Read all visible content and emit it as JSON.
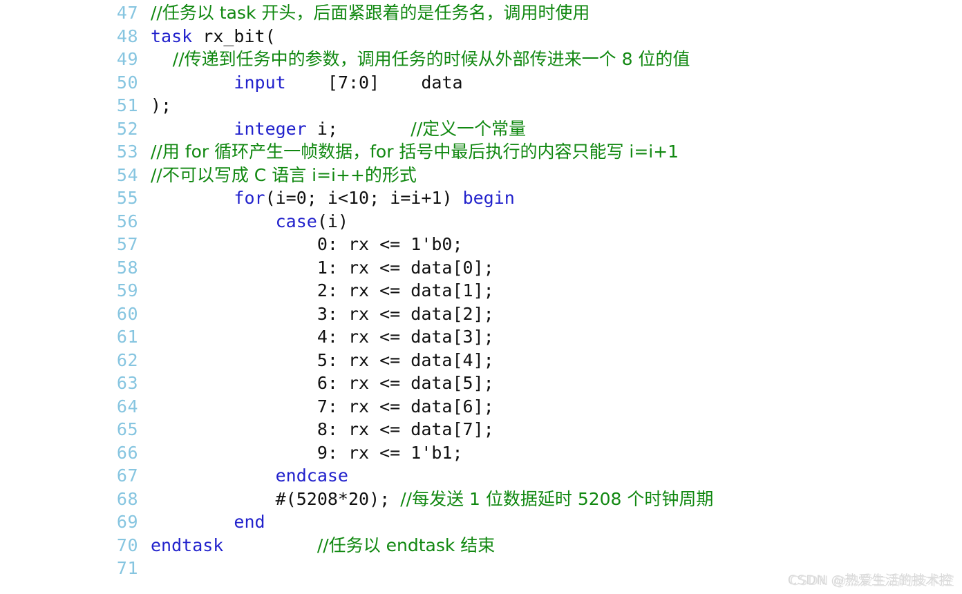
{
  "editor": {
    "language": "verilog",
    "first_line_number": 47,
    "colors": {
      "background": "#ffffff",
      "line_number": "#86c5e0",
      "keyword": "#2222cc",
      "comment": "#118811",
      "plain_text": "#111111",
      "watermark": "#d8d8d8"
    }
  },
  "watermark": {
    "text": "CSDN @热爱生活的技术控"
  },
  "lines": [
    {
      "number": "47",
      "tokens": [
        {
          "t": "//任务以 task 开头，后面紧跟着的是任务名，调用时使用",
          "c": "cmt"
        }
      ]
    },
    {
      "number": "48",
      "tokens": [
        {
          "t": "task",
          "c": "kw"
        },
        {
          "t": " rx_bit(",
          "c": "plain"
        }
      ]
    },
    {
      "number": "49",
      "tokens": [
        {
          "t": "    //传递到任务中的参数，调用任务的时候从外部传进来一个 8 位的值",
          "c": "cmt"
        }
      ]
    },
    {
      "number": "50",
      "tokens": [
        {
          "t": "        ",
          "c": "plain"
        },
        {
          "t": "input",
          "c": "kw"
        },
        {
          "t": "    [7:0]    data",
          "c": "plain"
        }
      ]
    },
    {
      "number": "51",
      "tokens": [
        {
          "t": ");",
          "c": "plain"
        }
      ]
    },
    {
      "number": "52",
      "tokens": [
        {
          "t": "        ",
          "c": "plain"
        },
        {
          "t": "integer",
          "c": "kw"
        },
        {
          "t": " i;       ",
          "c": "plain"
        },
        {
          "t": "//定义一个常量",
          "c": "cmt"
        }
      ]
    },
    {
      "number": "53",
      "tokens": [
        {
          "t": "//用 for 循环产生一帧数据，for 括号中最后执行的内容只能写 i=i+1",
          "c": "cmt"
        }
      ]
    },
    {
      "number": "54",
      "tokens": [
        {
          "t": "//不可以写成 C 语言 i=i++的形式",
          "c": "cmt"
        }
      ]
    },
    {
      "number": "55",
      "tokens": [
        {
          "t": "        ",
          "c": "plain"
        },
        {
          "t": "for",
          "c": "kw"
        },
        {
          "t": "(i=0; i<10; i=i+1) ",
          "c": "plain"
        },
        {
          "t": "begin",
          "c": "kw"
        }
      ]
    },
    {
      "number": "56",
      "tokens": [
        {
          "t": "            ",
          "c": "plain"
        },
        {
          "t": "case",
          "c": "kw"
        },
        {
          "t": "(i)",
          "c": "plain"
        }
      ]
    },
    {
      "number": "57",
      "tokens": [
        {
          "t": "                0: rx <= 1'b0;",
          "c": "plain"
        }
      ]
    },
    {
      "number": "58",
      "tokens": [
        {
          "t": "                1: rx <= data[0];",
          "c": "plain"
        }
      ]
    },
    {
      "number": "59",
      "tokens": [
        {
          "t": "                2: rx <= data[1];",
          "c": "plain"
        }
      ]
    },
    {
      "number": "60",
      "tokens": [
        {
          "t": "                3: rx <= data[2];",
          "c": "plain"
        }
      ]
    },
    {
      "number": "61",
      "tokens": [
        {
          "t": "                4: rx <= data[3];",
          "c": "plain"
        }
      ]
    },
    {
      "number": "62",
      "tokens": [
        {
          "t": "                5: rx <= data[4];",
          "c": "plain"
        }
      ]
    },
    {
      "number": "63",
      "tokens": [
        {
          "t": "                6: rx <= data[5];",
          "c": "plain"
        }
      ]
    },
    {
      "number": "64",
      "tokens": [
        {
          "t": "                7: rx <= data[6];",
          "c": "plain"
        }
      ]
    },
    {
      "number": "65",
      "tokens": [
        {
          "t": "                8: rx <= data[7];",
          "c": "plain"
        }
      ]
    },
    {
      "number": "66",
      "tokens": [
        {
          "t": "                9: rx <= 1'b1;",
          "c": "plain"
        }
      ]
    },
    {
      "number": "67",
      "tokens": [
        {
          "t": "            ",
          "c": "plain"
        },
        {
          "t": "endcase",
          "c": "kw"
        }
      ]
    },
    {
      "number": "68",
      "tokens": [
        {
          "t": "            #(5208*20); ",
          "c": "plain"
        },
        {
          "t": "//每发送 1 位数据延时 5208 个时钟周期",
          "c": "cmt"
        }
      ]
    },
    {
      "number": "69",
      "tokens": [
        {
          "t": "        ",
          "c": "plain"
        },
        {
          "t": "end",
          "c": "kw"
        }
      ]
    },
    {
      "number": "70",
      "tokens": [
        {
          "t": "endtask",
          "c": "kw"
        },
        {
          "t": "         ",
          "c": "plain"
        },
        {
          "t": "//任务以 endtask 结束",
          "c": "cmt"
        }
      ]
    },
    {
      "number": "71",
      "tokens": []
    }
  ]
}
